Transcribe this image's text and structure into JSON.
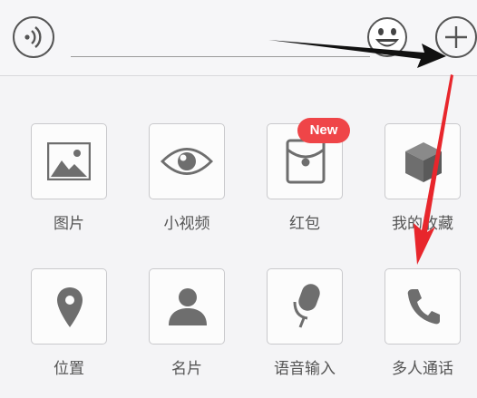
{
  "items": [
    {
      "label": "图片",
      "icon": "image-icon"
    },
    {
      "label": "小视频",
      "icon": "eye-icon"
    },
    {
      "label": "红包",
      "icon": "red-packet-icon"
    },
    {
      "label": "我的收藏",
      "icon": "cube-icon"
    },
    {
      "label": "位置",
      "icon": "location-pin-icon"
    },
    {
      "label": "名片",
      "icon": "person-icon"
    },
    {
      "label": "语音输入",
      "icon": "microphone-icon"
    },
    {
      "label": "多人通话",
      "icon": "phone-icon"
    }
  ],
  "badge_text": "New",
  "colors": {
    "badge": "#ef4548",
    "arrow_black": "#111111",
    "arrow_red": "#e8262c",
    "icon_gray": "#6e6e6e"
  }
}
